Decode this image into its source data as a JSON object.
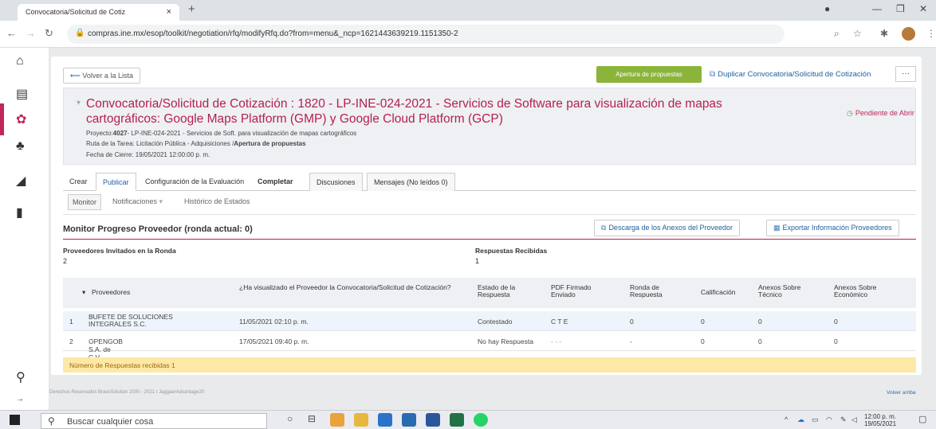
{
  "browser": {
    "tab_title": "Convocatoria/Solicitud de Cotiz",
    "tab_close": "×",
    "new_tab": "+",
    "url": "compras.ine.mx/esop/toolkit/negotiation/rfq/modifyRfq.do?from=menu&_ncp=1621443639219.1151350-2"
  },
  "actions": {
    "back_list": "Volver a la Lista",
    "open_proposals": "Apertura de propuestas",
    "duplicate": "Duplicar Convocatoria/Solicitud de Cotización",
    "more": "···"
  },
  "header": {
    "title": "Convocatoria/Solicitud de Cotización : 1820 - LP-INE-024-2021 - Servicios de Software para visualización de mapas cartográficos: Google Maps Platform (GMP) y Google Cloud Platform (GCP)",
    "project_label": "Proyecto:",
    "project_value": "4027",
    "project_desc": "- LP-INE-024-2021 - Servicios de Soft. para visualización de mapas cartográficos",
    "route_text": "Ruta de la Tarea: Licitación Pública - Adquisiciones /",
    "route_bold": "Apertura de propuestas",
    "close_date": "Fecha de Cierre: 19/05/2021 12:00:00 p. m.",
    "status": "Pendiente de Abrir"
  },
  "tabs": [
    "Crear",
    "Publicar",
    "Configuración de la Evaluación",
    "Completar",
    "Discusiones",
    "Mensajes (No leídos 0)"
  ],
  "subtabs": {
    "monitor": "Monitor",
    "notifications": "Notificaciones",
    "history": "Histórico de Estados"
  },
  "monitor": {
    "title": "Monitor Progreso Proveedor (ronda actual: 0)",
    "download_btn": "Descarga de los Anexos del Proveedor",
    "export_btn": "Exportar Información Proveedores",
    "invited_label": "Proveedores Invitados en la Ronda",
    "invited_value": "2",
    "received_label": "Respuestas Recibidas",
    "received_value": "1"
  },
  "table": {
    "headers": [
      "Proveedores",
      "¿Ha visualizado el Proveedor la Convocatoria/Solicitud de Cotización?",
      "Estado de la Respuesta",
      "PDF Firmado Enviado",
      "Ronda de Respuesta",
      "Calificación",
      "Anexos Sobre Técnico",
      "Anexos Sobre Económico"
    ],
    "rows": [
      {
        "n": "1",
        "supplier": "BUFETE DE SOLUCIONES INTEGRALES S.C.",
        "viewed": "11/05/2021 02:10 p. m.",
        "state": "Contestado",
        "pdf": "C T E",
        "round": "0",
        "grade": "0",
        "tech": "0",
        "econ": "0"
      },
      {
        "n": "2",
        "supplier": "OPENGOB S.A. de C.V.",
        "viewed": "17/05/2021 09:40 p. m.",
        "state": "No hay Respuesta",
        "pdf": "- - -",
        "round": "-",
        "grade": "0",
        "tech": "0",
        "econ": "0"
      }
    ],
    "footer": "Número de Respuestas recibidas 1"
  },
  "page_footer": {
    "copyright": "Derechos Reservados BravoSolution 2000 - 2021 / JaggaerAdvantage20",
    "back_top": "Volver arriba"
  },
  "taskbar": {
    "search_placeholder": "Buscar cualquier cosa",
    "time": "12:00 p. m.",
    "date": "19/05/2021"
  },
  "colors": {
    "accent": "#b5204f",
    "green": "#8bb43b",
    "link": "#1f5e9e",
    "warning": "#fde9a5"
  }
}
